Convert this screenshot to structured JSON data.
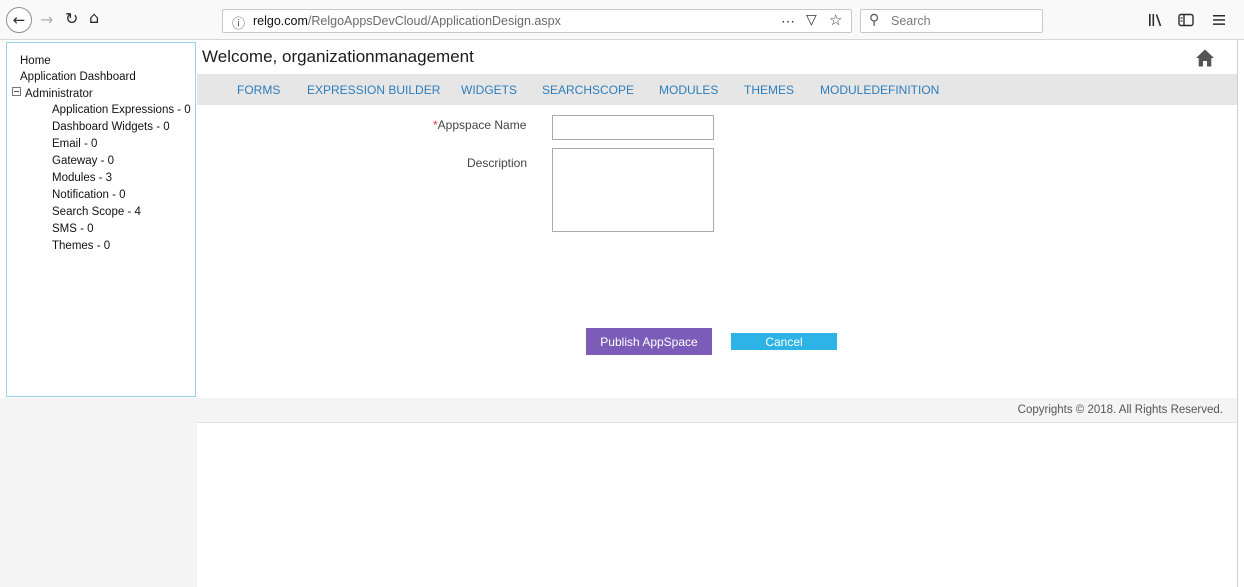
{
  "browser": {
    "url_domain": "relgo.com",
    "url_path": "/RelgoAppsDevCloud/ApplicationDesign.aspx",
    "search_placeholder": "Search",
    "icons": {
      "back": "back-arrow-icon",
      "forward": "forward-arrow-icon",
      "reload": "reload-icon",
      "home": "home-icon",
      "info": "info-icon",
      "page_actions": "more-dots-icon",
      "pocket": "pocket-icon",
      "bookmark": "star-icon",
      "search": "search-icon",
      "library": "library-icon",
      "sidebar": "sidebar-icon",
      "menu": "hamburger-menu-icon"
    }
  },
  "sidebar": {
    "items": [
      {
        "label": "Home"
      },
      {
        "label": "Application Dashboard"
      },
      {
        "label": "Administrator"
      }
    ],
    "admin_children": [
      {
        "label": "Application Expressions - 0"
      },
      {
        "label": "Dashboard Widgets - 0"
      },
      {
        "label": "Email - 0"
      },
      {
        "label": "Gateway - 0"
      },
      {
        "label": "Modules - 3"
      },
      {
        "label": "Notification - 0"
      },
      {
        "label": "Search Scope - 4"
      },
      {
        "label": "SMS - 0"
      },
      {
        "label": "Themes - 0"
      }
    ]
  },
  "header": {
    "welcome": "Welcome, organizationmanagement",
    "home_icon": "home-icon"
  },
  "menu": {
    "items": [
      {
        "label": "FORMS"
      },
      {
        "label": "EXPRESSION BUILDER"
      },
      {
        "label": "WIDGETS"
      },
      {
        "label": "SEARCHSCOPE"
      },
      {
        "label": "MODULES"
      },
      {
        "label": "THEMES"
      },
      {
        "label": "MODULEDEFINITION"
      }
    ]
  },
  "form": {
    "required_mark": "*",
    "name_label": "Appspace Name",
    "name_value": "",
    "description_label": "Description",
    "description_value": "",
    "publish_label": "Publish AppSpace",
    "cancel_label": "Cancel"
  },
  "footer": {
    "text": "Copyrights © 2018. All Rights Reserved."
  },
  "colors": {
    "menu_link": "#2e7dba",
    "publish_button": "#7b5cb8",
    "cancel_button": "#2eb3e6",
    "nav_border": "#9ad2ee",
    "required": "#e53030"
  }
}
